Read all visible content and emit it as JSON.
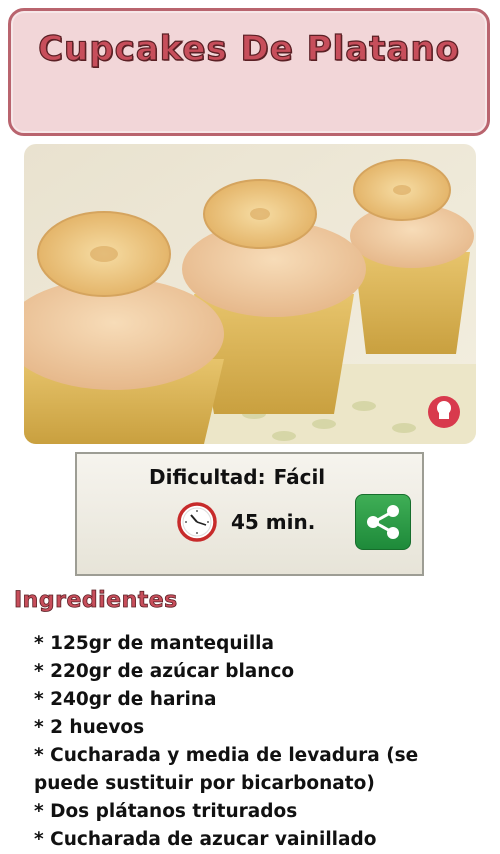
{
  "header": {
    "title": "Cupcakes De Platano"
  },
  "photo": {
    "description_icon": "chef-hat-logo-icon"
  },
  "info": {
    "difficulty_label": "Dificultad:",
    "difficulty_value": "Fácil",
    "time": "45 min.",
    "clock_icon": "clock-icon",
    "share_icon": "share-icon"
  },
  "ingredients": {
    "title": "Ingredientes",
    "items": [
      "* 125gr de mantequilla",
      "* 220gr de azúcar blanco",
      "* 240gr de harina",
      "* 2 huevos",
      "* Cucharada y media de levadura (se puede sustituir por bicarbonato)",
      "* Dos plátanos triturados",
      "* Cucharada de azucar vainillado"
    ]
  },
  "colors": {
    "title_text": "#c74e5b",
    "title_bg": "#f2d6d8",
    "share_bg": "#2e9d48"
  }
}
